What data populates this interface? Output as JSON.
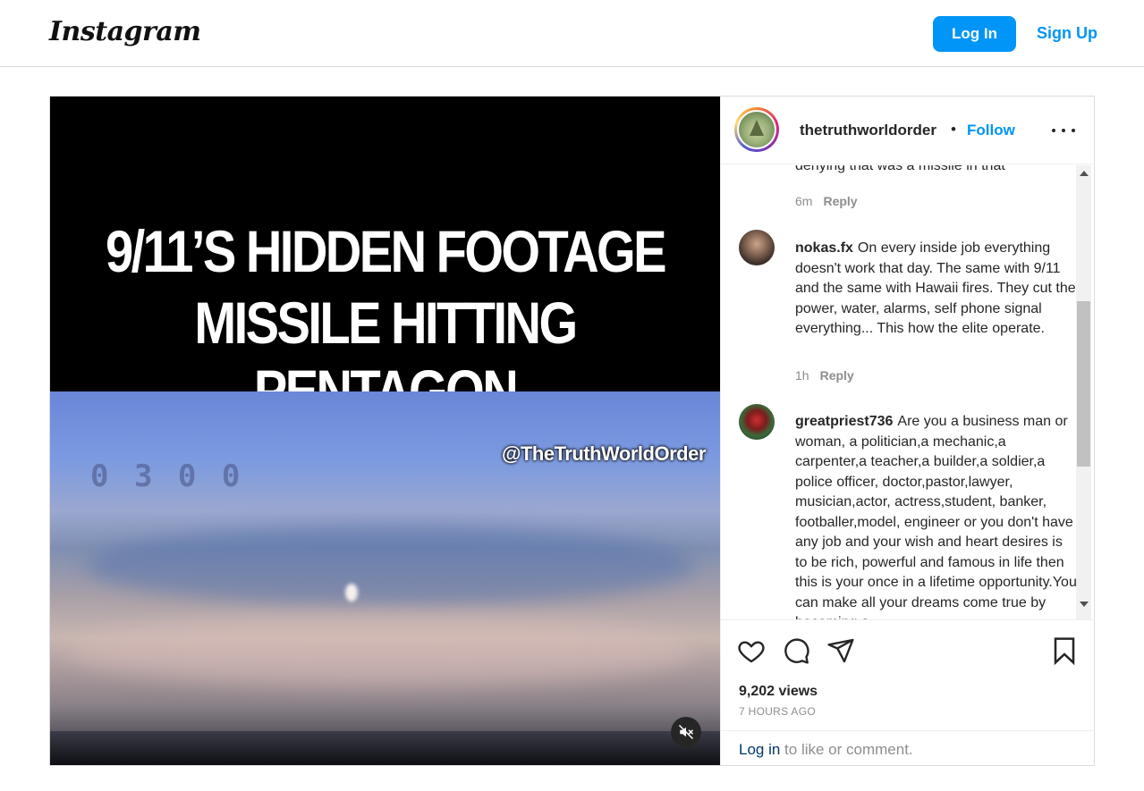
{
  "header": {
    "logo_text": "Instagram",
    "login_label": "Log In",
    "signup_label": "Sign Up"
  },
  "media": {
    "headline_line1": "9/11’S HIDDEN FOOTAGE",
    "headline_line2": "MISSILE HITTING PENTAGON",
    "watermark": "@TheTruthWorldOrder",
    "muted_icon": "speaker-muted-icon"
  },
  "post": {
    "username": "thetruthworldorder",
    "dot": "•",
    "follow_label": "Follow",
    "more_icon": "more-options-icon"
  },
  "comments": [
    {
      "username": "",
      "text": "denying that was a missile in that",
      "time": "6m",
      "reply_label": "Reply"
    },
    {
      "username": "nokas.fx",
      "text": "On every inside job everything doesn't work that day. The same with 9/11 and the same with Hawaii fires. They cut the power, water, alarms, self phone signal everything... This how the elite operate.",
      "time": "1h",
      "reply_label": "Reply"
    },
    {
      "username": "greatpriest736",
      "text": "Are you a business man or woman, a politician,a mechanic,a carpenter,a teacher,a builder,a soldier,a police officer, doctor,pastor,lawyer, musician,actor, actress,student, banker, footballer,model, engineer or you don't have any job and your wish and heart desires is to be rich, powerful and famous in life then this is your once in a lifetime opportunity.You can make all your dreams come true by becoming a"
    }
  ],
  "actions": {
    "icons": [
      "heart-icon",
      "comment-icon",
      "share-icon",
      "bookmark-icon"
    ],
    "views": "9,202 views",
    "time_ago": "7 HOURS AGO",
    "login_link": "Log in",
    "login_suffix": " to like or comment."
  },
  "colors": {
    "accent": "#0095f6",
    "text": "#262626",
    "muted": "#8e8e8e",
    "border": "#dbdbdb"
  }
}
